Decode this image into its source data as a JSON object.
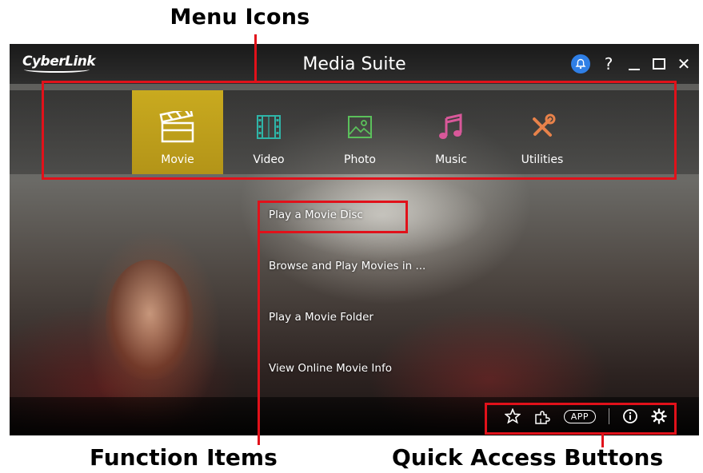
{
  "annotations": {
    "menu_icons": "Menu Icons",
    "function_items": "Function Items",
    "quick_access": "Quick Access Buttons"
  },
  "window": {
    "brand": "CyberLink",
    "title": "Media Suite",
    "controls": {
      "help": "?",
      "close": "✕"
    }
  },
  "menu": {
    "items": [
      {
        "label": "Movie",
        "icon": "clapperboard-icon",
        "active": true
      },
      {
        "label": "Video",
        "icon": "film-strip-icon",
        "color": "#2fb5a8"
      },
      {
        "label": "Photo",
        "icon": "photo-icon",
        "color": "#5bc05b"
      },
      {
        "label": "Music",
        "icon": "music-note-icon",
        "color": "#d9589a"
      },
      {
        "label": "Utilities",
        "icon": "tools-icon",
        "color": "#e8824a"
      }
    ]
  },
  "function_items": [
    "Play a Movie Disc",
    "Browse and Play Movies in ...",
    "Play a Movie Folder",
    "View Online Movie Info"
  ],
  "quick_access": {
    "buttons": [
      {
        "name": "favorites",
        "icon": "star-icon"
      },
      {
        "name": "plugins",
        "icon": "puzzle-icon"
      },
      {
        "name": "app",
        "label": "APP"
      },
      {
        "name": "info",
        "icon": "info-icon"
      },
      {
        "name": "settings",
        "icon": "gear-icon"
      }
    ]
  },
  "colors": {
    "annotation_red": "#e1111a",
    "active_menu": "#c9aa1f",
    "notification_blue": "#2f7fe6"
  }
}
